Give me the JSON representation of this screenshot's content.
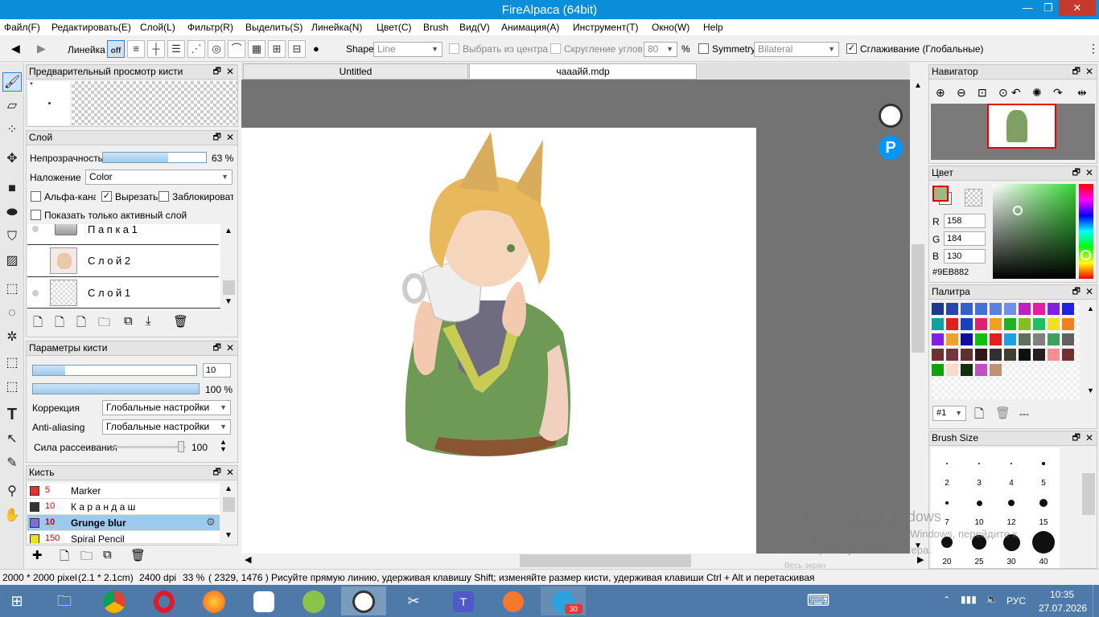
{
  "window": {
    "title": "FireAlpaca (64bit)",
    "min": "—",
    "max": "❐",
    "close": "✕"
  },
  "menu": [
    "Файл(F)",
    "Редактировать(E)",
    "Слой(L)",
    "Фильтр(R)",
    "Выделить(S)",
    "Линейка(N)",
    "Цвет(C)",
    "Brush",
    "Вид(V)",
    "Анимация(A)",
    "Инструмент(T)",
    "Окно(W)",
    "Help"
  ],
  "toolbar": {
    "ruler_label": "Линейка",
    "off_label": "off",
    "shape_label": "Shape",
    "shape_value": "Line",
    "from_center_label": "Выбрать из центра",
    "round_corners_label": "Скругление углов",
    "round_value": "80",
    "percent": "%",
    "symmetry_label": "Symmetry",
    "symmetry_value": "Bilateral",
    "antialias_label": "Сглаживание (Глобальные)"
  },
  "brush_preview": {
    "title": "Предварительный просмотр кисти",
    "star": "*"
  },
  "layer_panel": {
    "title": "Слой",
    "opacity_label": "Непрозрачность",
    "opacity_value": "63 %",
    "opacity_fraction": 0.63,
    "blend_label": "Наложение",
    "blend_value": "Color",
    "alpha_label": "Альфа-канал",
    "clip_label": "Вырезать",
    "lock_label": "Заблокировать",
    "show_active_label": "Показать только активный слой",
    "layers": [
      {
        "name": "П а п к а 1"
      },
      {
        "name": "С л о й 2"
      },
      {
        "name": "С л о й 1"
      }
    ]
  },
  "brush_params": {
    "title": "Параметры кисти",
    "size_value": "10",
    "opacity_value": "100 %",
    "correction_label": "Коррекция",
    "correction_value": "Глобальные настройки",
    "aa_label": "Anti-aliasing",
    "aa_value": "Глобальные настройки",
    "scatter_label": "Сила рассеивания",
    "scatter_value": "100"
  },
  "brush_list": {
    "title": "Кисть",
    "items": [
      {
        "size": "5",
        "name": "Marker",
        "color": "#e83030"
      },
      {
        "size": "10",
        "name": "К а р а н д а ш",
        "color": "#333333"
      },
      {
        "size": "10",
        "name": "Grunge blur",
        "color": "#7a6ee0"
      },
      {
        "size": "150",
        "name": "Spiral Pencil",
        "color": "#e8e020"
      }
    ]
  },
  "tabs": [
    {
      "label": "Untitled"
    },
    {
      "label": "чааайй.mdp"
    }
  ],
  "navigator": {
    "title": "Навигатор"
  },
  "color_panel": {
    "title": "Цвет",
    "r_label": "R",
    "r": "158",
    "g_label": "G",
    "g": "184",
    "b_label": "B",
    "b": "130",
    "hex": "#9EB882",
    "current": "#9eb882"
  },
  "palette": {
    "title": "Палитра",
    "selector": "#1",
    "dashes": "---",
    "colors": [
      "#1e3a8a",
      "#2848a8",
      "#3560c8",
      "#4070d8",
      "#5a80e0",
      "#7090e8",
      "#c020c0",
      "#e020a0",
      "#8020e0",
      "#2020e0",
      "#10a0a0",
      "#e02020",
      "#1840c0",
      "#e02070",
      "#f0a020",
      "#20b020",
      "#80c020",
      "#20c060",
      "#f0e020",
      "#f08020",
      "#8020e0",
      "#f0a030",
      "#1010a0",
      "#10c010",
      "#e02020",
      "#20a0e0",
      "#607060",
      "#808080",
      "#40a060",
      "#606060",
      "#703030",
      "#703838",
      "#603030",
      "#301818",
      "#303030",
      "#404030",
      "#101010",
      "#282020",
      "#f09090",
      "#703030",
      "#10a010",
      "#f8dcc8",
      "#103010",
      "#c050c0",
      "#c09070"
    ]
  },
  "brush_size": {
    "title": "Brush Size",
    "sizes": [
      "2",
      "3",
      "4",
      "5",
      "7",
      "10",
      "12",
      "15",
      "20",
      "25",
      "30",
      "40"
    ]
  },
  "status": {
    "dims": "2000 * 2000 pixel",
    "cm": "(2.1 * 2.1cm)",
    "dpi": "2400 dpi",
    "zoom": "33 %",
    "coords": "( 2329, 1476 )",
    "hint": "Рисуйте прямую линию, удерживая клавишу Shift; изменяйте размер кисти, удерживая клавиши Ctrl + Alt и перетаскивая"
  },
  "watermark": {
    "line1": "Активация Windows",
    "line2": "Чтобы активировать Windows, перейдите к",
    "line3": "параметрам компьютера.",
    "fullscreen": "Весь экран"
  },
  "taskbar": {
    "lang": "РУС",
    "time": "10:35",
    "date": "27.07.2026",
    "badge": "30"
  }
}
